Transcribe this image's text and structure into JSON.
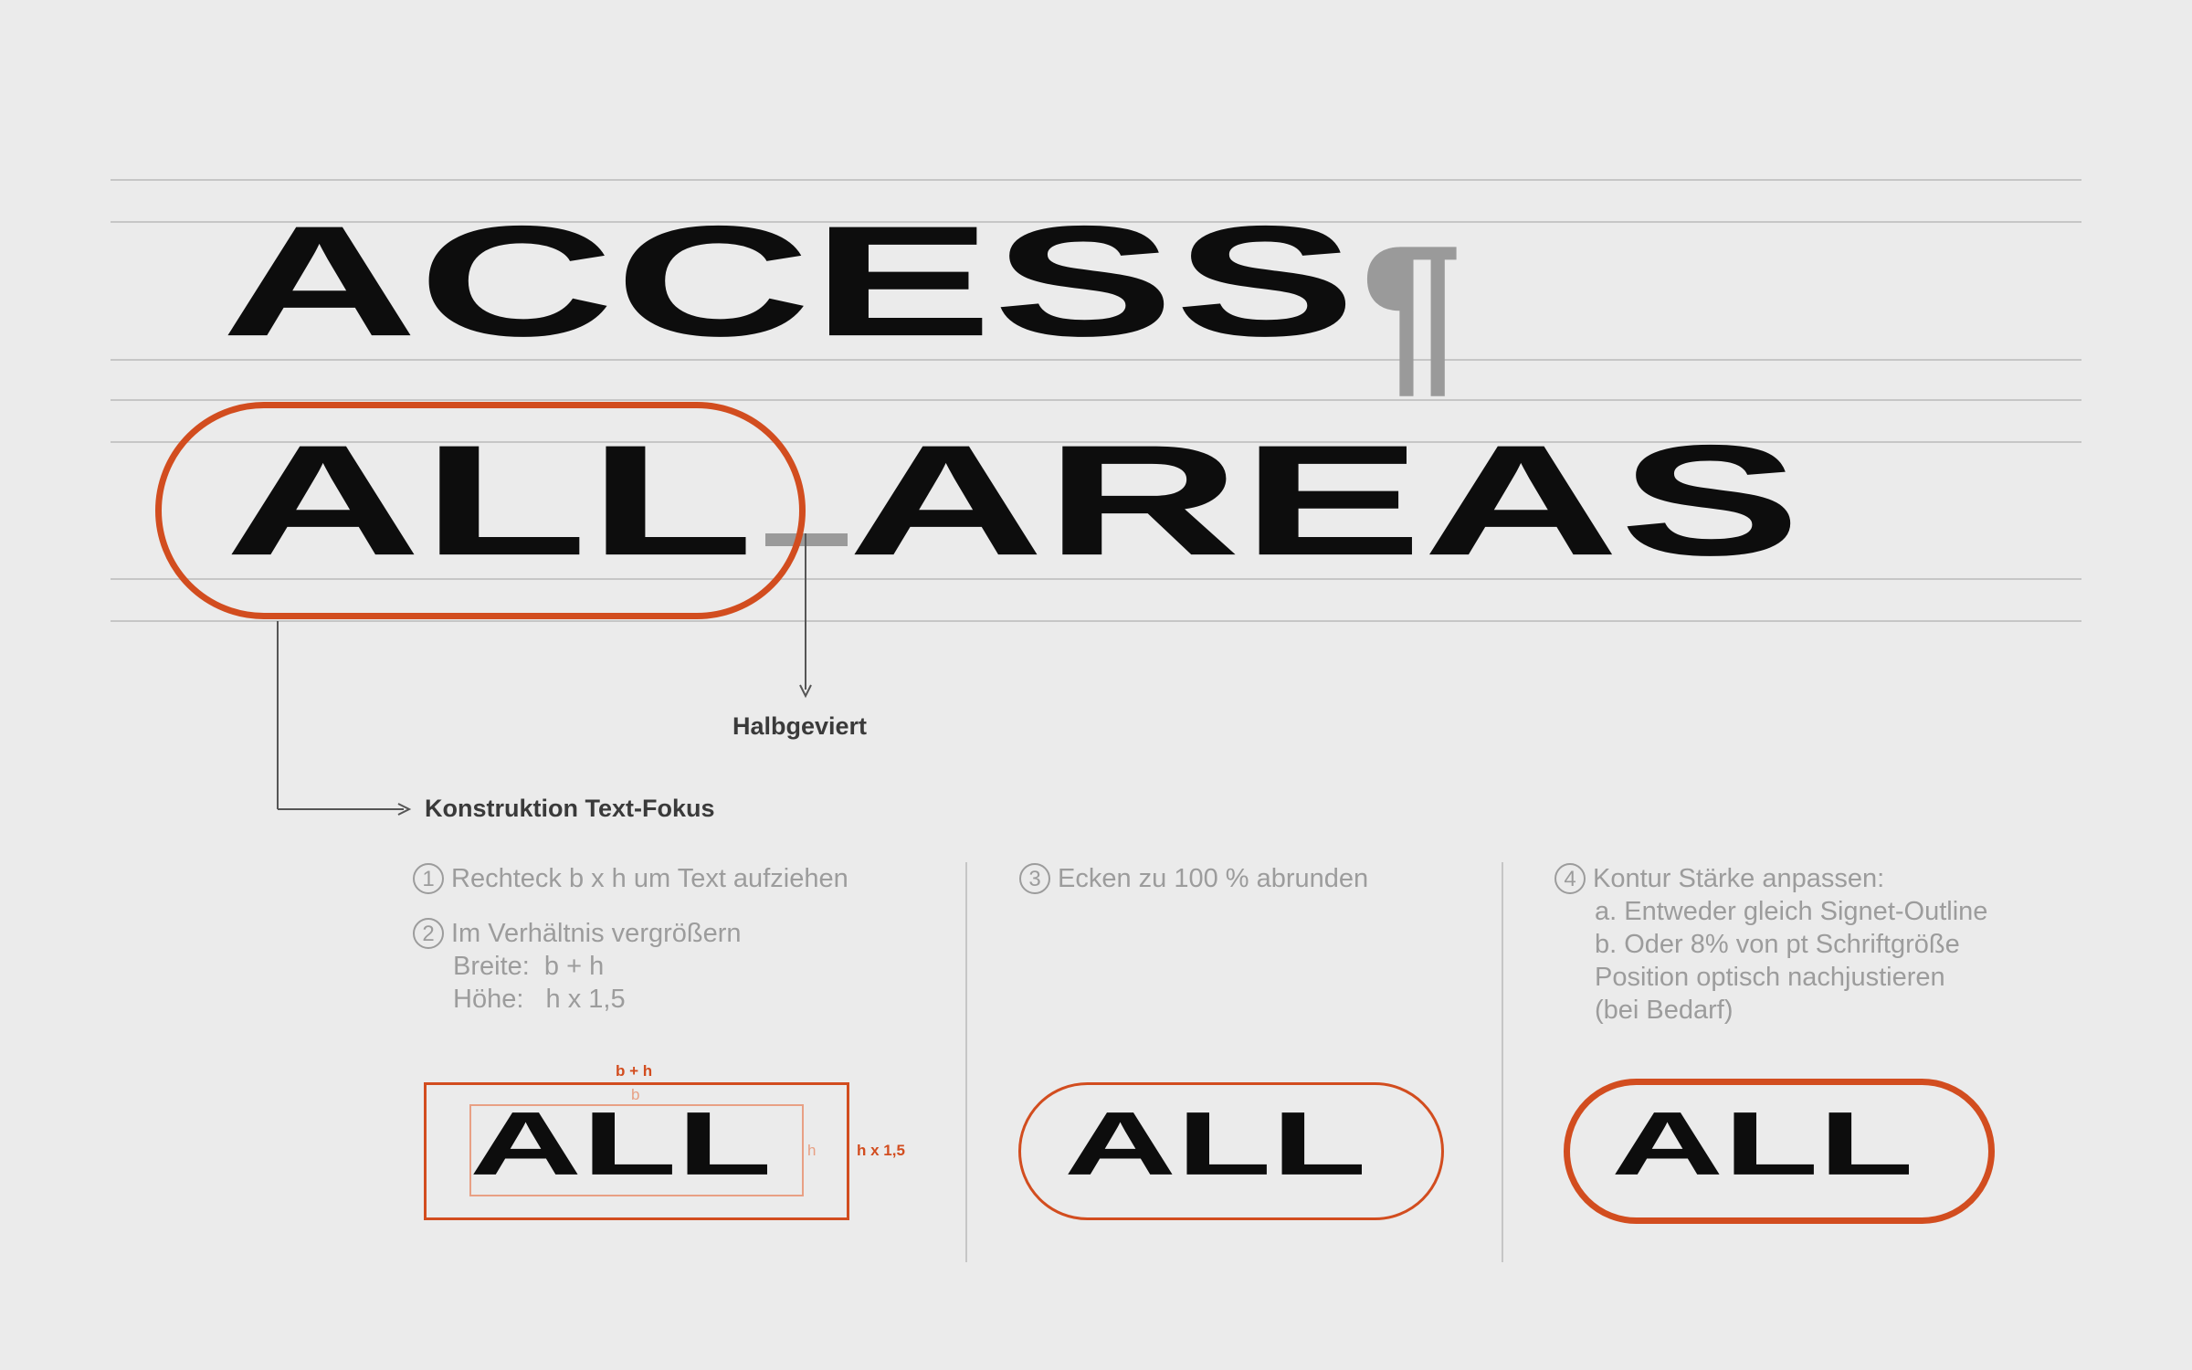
{
  "headline": {
    "line1": "ACCESS",
    "pilcrow": "¶",
    "line2_word1": "ALL",
    "line2_word2": "AREAS"
  },
  "annotations": {
    "halbgeviert": "Halbgeviert",
    "konstruktion": "Konstruktion Text-Fokus"
  },
  "steps": {
    "s1_num": "1",
    "s1_text": "Rechteck b x h um Text aufziehen",
    "s2_num": "2",
    "s2_text": "Im Verhältnis vergrößern",
    "s2_line2": "Breite:  b + h",
    "s2_line3": "Höhe:   h x 1,5",
    "s3_num": "3",
    "s3_text": "Ecken zu 100 % abrunden",
    "s4_num": "4",
    "s4_text": "Kontur Stärke anpassen:",
    "s4_line2": "a. Entweder gleich Signet-Outline",
    "s4_line3": "b. Oder 8% von pt Schriftgröße",
    "s4_line4": "Position optisch nachjustieren",
    "s4_line5": "(bei Bedarf)"
  },
  "examples": {
    "word": "ALL",
    "label_bh": "b + h",
    "label_b": "b",
    "label_h": "h",
    "label_h15": "h x 1,5"
  },
  "colors": {
    "accent": "#d24d1f",
    "text": "#0d0d0d",
    "muted": "#9c9c9c",
    "background": "#ebebeb"
  }
}
